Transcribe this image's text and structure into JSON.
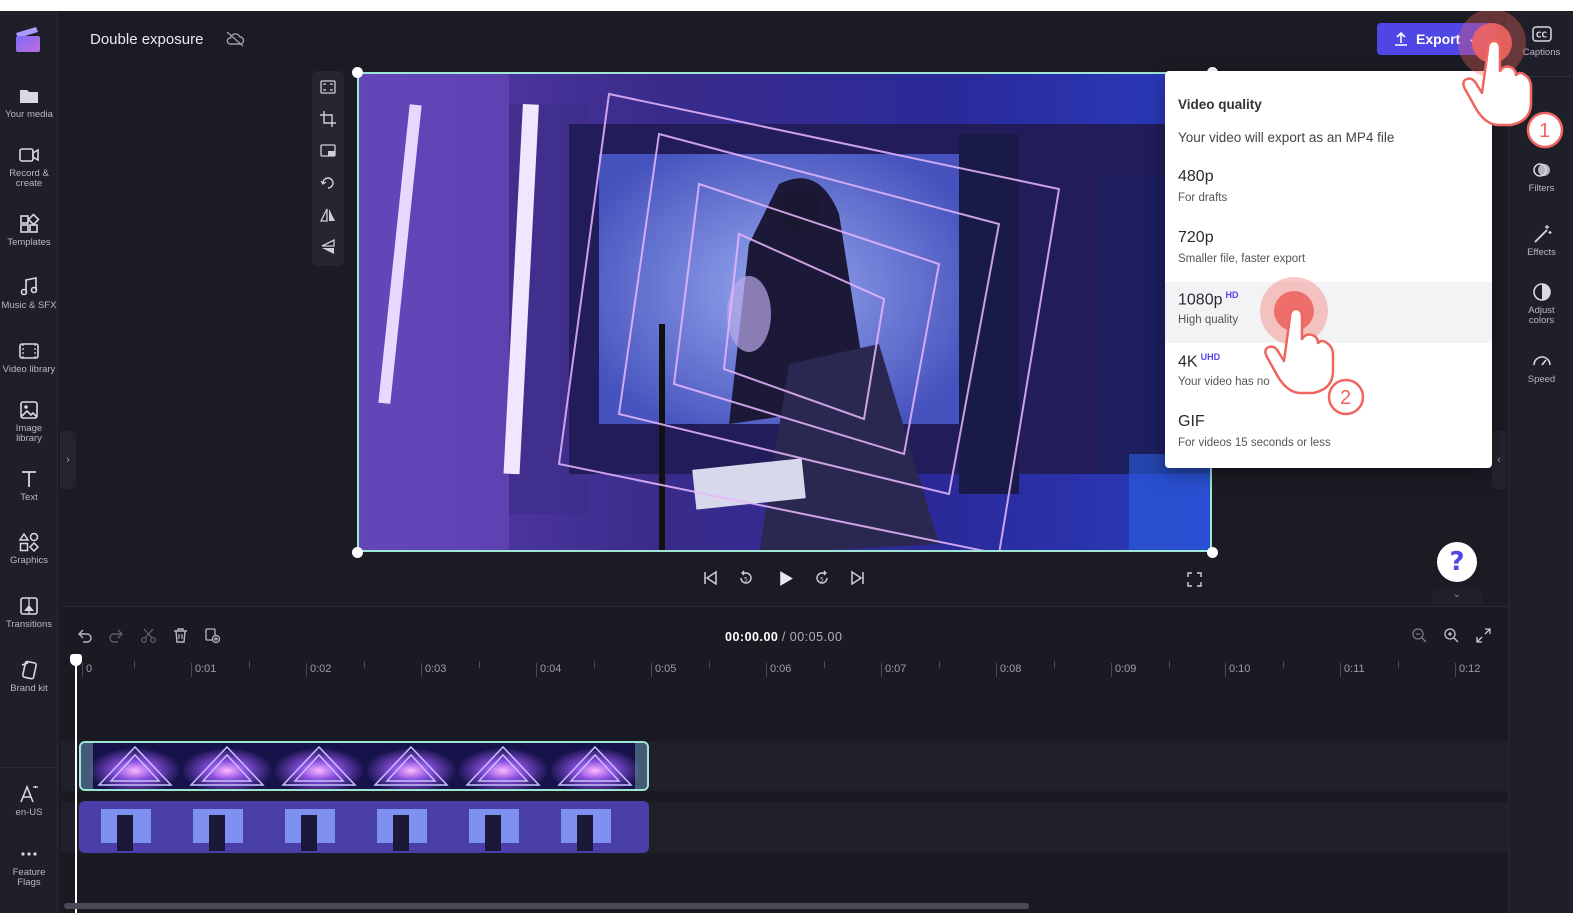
{
  "app": {
    "project_title": "Double exposure",
    "export_label": "Export"
  },
  "left_nav": [
    {
      "name": "your-media",
      "label": "Your media"
    },
    {
      "name": "record-create",
      "label": "Record & create"
    },
    {
      "name": "templates",
      "label": "Templates"
    },
    {
      "name": "music-sfx",
      "label": "Music & SFX"
    },
    {
      "name": "video-library",
      "label": "Video library"
    },
    {
      "name": "image-library",
      "label": "Image library"
    },
    {
      "name": "text",
      "label": "Text"
    },
    {
      "name": "graphics",
      "label": "Graphics"
    },
    {
      "name": "transitions",
      "label": "Transitions"
    },
    {
      "name": "brand-kit",
      "label": "Brand kit"
    }
  ],
  "left_nav_bottom": [
    {
      "name": "language",
      "label": "en-US"
    },
    {
      "name": "feature-flags",
      "label": "Feature Flags"
    }
  ],
  "right_panel": [
    {
      "name": "captions",
      "label": "Captions"
    },
    {
      "name": "filters",
      "label": "Filters"
    },
    {
      "name": "effects",
      "label": "Effects"
    },
    {
      "name": "adjust-colors",
      "label": "Adjust colors"
    },
    {
      "name": "speed",
      "label": "Speed"
    }
  ],
  "export_menu": {
    "title": "Video quality",
    "subtitle": "Your video will export as an MP4 file",
    "options": [
      {
        "name": "480p",
        "badge": "",
        "desc": "For drafts",
        "selected": false
      },
      {
        "name": "720p",
        "badge": "",
        "desc": "Smaller file, faster export",
        "selected": false
      },
      {
        "name": "1080p",
        "badge": "HD",
        "desc": "High quality",
        "selected": true
      },
      {
        "name": "4K",
        "badge": "UHD",
        "desc": "Your video has no",
        "selected": false
      },
      {
        "name": "GIF",
        "badge": "",
        "desc": "For videos 15 seconds or less",
        "selected": false
      }
    ]
  },
  "annotations": {
    "step1": "1",
    "step2": "2"
  },
  "playback": {
    "current_time": "00:00.00",
    "total_time": "/ 00:05.00"
  },
  "help_label": "?",
  "timeline": {
    "ticks": [
      "0",
      "0:01",
      "0:02",
      "0:03",
      "0:04",
      "0:05",
      "0:06",
      "0:07",
      "0:08",
      "0:09",
      "0:10",
      "0:11",
      "0:12"
    ]
  },
  "colors": {
    "accent": "#4f46e5",
    "selection": "#9ee5d4",
    "annotation": "#f0655f"
  }
}
